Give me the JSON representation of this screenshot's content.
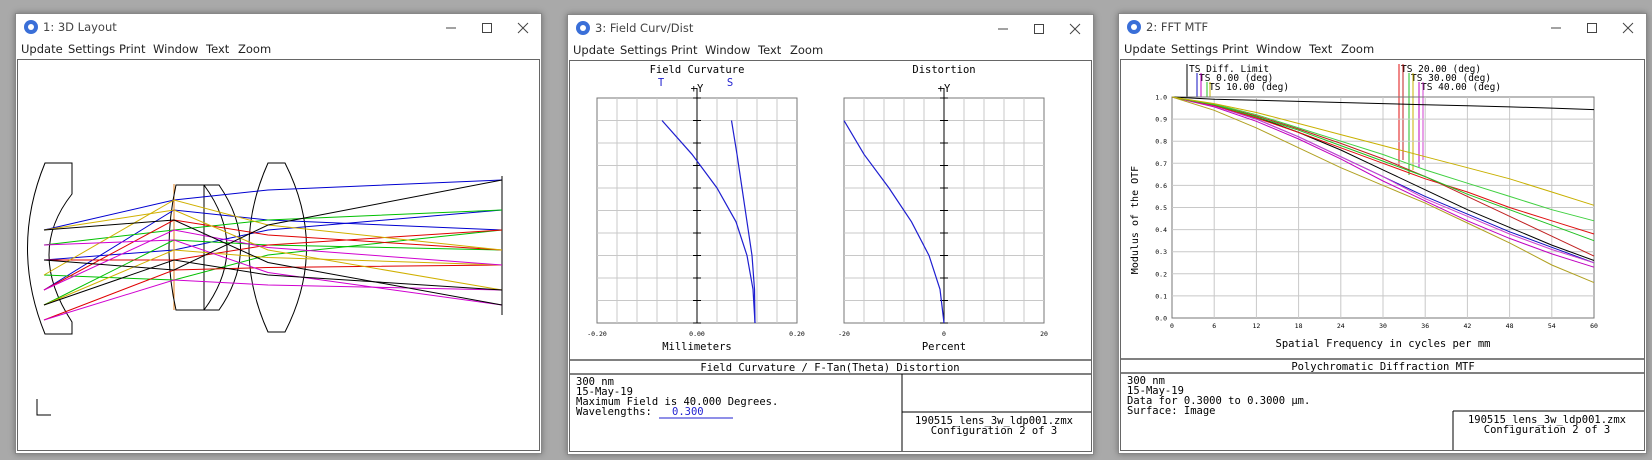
{
  "windows": [
    {
      "title": "1: 3D Layout",
      "menu": [
        "Update",
        "Settings",
        "Print",
        "Window",
        "Text",
        "Zoom"
      ]
    },
    {
      "title": "3: Field Curv/Dist",
      "menu": [
        "Update",
        "Settings",
        "Print",
        "Window",
        "Text",
        "Zoom"
      ],
      "field_curvature": {
        "heading": "Field Curvature",
        "t_label": "T",
        "s_label": "S",
        "y_label": "+Y",
        "x_ticks": [
          "-0.20",
          "0.00",
          "0.20"
        ],
        "xlabel": "Millimeters"
      },
      "distortion": {
        "heading": "Distortion",
        "y_label": "+Y",
        "x_ticks": [
          "-20",
          "0",
          "20"
        ],
        "xlabel": "Percent"
      },
      "footer_title": "Field Curvature / F-Tan(Theta) Distortion",
      "info_lines": [
        "300 nm",
        "15-May-19",
        "Maximum Field is 40.000 Degrees."
      ],
      "wavelengths_label": "Wavelengths:",
      "wavelengths_value": "0.300",
      "file": "190515_lens_3w_ldp001.zmx",
      "config": "Configuration 2 of 3"
    },
    {
      "title": "2: FFT MTF",
      "menu": [
        "Update",
        "Settings",
        "Print",
        "Window",
        "Text",
        "Zoom"
      ],
      "legend": {
        "diff": "TS Diff. Limit",
        "f0": "TS 0.00 (deg)",
        "f10": "TS 10.00 (deg)",
        "f20": "TS 20.00 (deg)",
        "f30": "TS 30.00 (deg)",
        "f40": "TS 40.00 (deg)"
      },
      "y_ticks": [
        "0.0",
        "0.1",
        "0.2",
        "0.3",
        "0.4",
        "0.5",
        "0.6",
        "0.7",
        "0.8",
        "0.9",
        "1.0"
      ],
      "x_ticks": [
        "0",
        "6",
        "12",
        "18",
        "24",
        "30",
        "36",
        "42",
        "48",
        "54",
        "60"
      ],
      "ylabel": "Modulus of the OTF",
      "xlabel": "Spatial Frequency in cycles per mm",
      "footer_title": "Polychromatic Diffraction MTF",
      "info_lines": [
        "300 nm",
        "15-May-19",
        "Data for 0.3000 to 0.3000 µm.",
        "Surface: Image"
      ],
      "file": "190515_lens_3w_ldp001.zmx",
      "config": "Configuration 2 of 3"
    }
  ],
  "chart_data": [
    {
      "type": "line",
      "title": "Field Curvature",
      "xlabel": "Millimeters",
      "xlim": [
        -0.2,
        0.2
      ],
      "ylim": [
        0,
        40
      ],
      "series": [
        {
          "name": "T",
          "x": [
            0.116,
            0.112,
            0.1,
            0.078,
            0.04,
            -0.01,
            -0.07
          ],
          "y": [
            0,
            6,
            12,
            18,
            24,
            30,
            36
          ]
        },
        {
          "name": "S",
          "x": [
            0.116,
            0.115,
            0.11,
            0.1,
            0.09,
            0.08,
            0.069
          ],
          "y": [
            0,
            6,
            12,
            18,
            24,
            30,
            36
          ]
        }
      ],
      "colors": {
        "T": "#1f1fd0",
        "S": "#1f1fd0"
      }
    },
    {
      "type": "line",
      "title": "Distortion",
      "xlabel": "Percent",
      "xlim": [
        -20,
        20
      ],
      "ylim": [
        0,
        40
      ],
      "series": [
        {
          "x": [
            0,
            -0.8,
            -3,
            -6.5,
            -11,
            -16,
            -20
          ],
          "y": [
            0,
            6,
            12,
            18,
            24,
            30,
            36
          ]
        }
      ]
    },
    {
      "type": "line",
      "title": "Polychromatic Diffraction MTF",
      "xlabel": "Spatial Frequency in cycles per mm",
      "ylabel": "Modulus of the OTF",
      "xlim": [
        0,
        60
      ],
      "ylim": [
        0,
        1
      ],
      "x": [
        0,
        6,
        12,
        18,
        24,
        30,
        36,
        42,
        48,
        54,
        60
      ],
      "series": [
        {
          "name": "TS Diff. Limit",
          "color": "#000000",
          "values": [
            1.0,
            0.99,
            0.985,
            0.98,
            0.975,
            0.97,
            0.965,
            0.96,
            0.955,
            0.95,
            0.943
          ]
        },
        {
          "name": "TS 0.00 (deg) T",
          "color": "#1010c0",
          "values": [
            1.0,
            0.96,
            0.9,
            0.82,
            0.73,
            0.64,
            0.55,
            0.47,
            0.39,
            0.32,
            0.25
          ]
        },
        {
          "name": "TS 0.00 (deg) S",
          "color": "#000000",
          "values": [
            1.0,
            0.965,
            0.91,
            0.84,
            0.76,
            0.67,
            0.58,
            0.49,
            0.41,
            0.33,
            0.26
          ]
        },
        {
          "name": "TS 10.00 (deg) T",
          "color": "#c000c0",
          "values": [
            1.0,
            0.955,
            0.89,
            0.81,
            0.72,
            0.62,
            0.53,
            0.44,
            0.36,
            0.29,
            0.23
          ]
        },
        {
          "name": "TS 10.00 (deg) S",
          "color": "#d040d0",
          "values": [
            1.0,
            0.96,
            0.9,
            0.82,
            0.73,
            0.64,
            0.54,
            0.46,
            0.38,
            0.31,
            0.25
          ]
        },
        {
          "name": "TS 20.00 (deg) T",
          "color": "#e01010",
          "values": [
            1.0,
            0.962,
            0.905,
            0.84,
            0.77,
            0.7,
            0.63,
            0.57,
            0.5,
            0.44,
            0.38
          ]
        },
        {
          "name": "TS 20.00 (deg) S",
          "color": "#c02020",
          "values": [
            1.0,
            0.965,
            0.915,
            0.855,
            0.79,
            0.72,
            0.64,
            0.55,
            0.46,
            0.37,
            0.28
          ]
        },
        {
          "name": "TS 30.00 (deg) T",
          "color": "#20c020",
          "values": [
            1.0,
            0.965,
            0.91,
            0.85,
            0.78,
            0.71,
            0.64,
            0.56,
            0.49,
            0.42,
            0.35
          ]
        },
        {
          "name": "TS 30.00 (deg) S",
          "color": "#40d040",
          "values": [
            1.0,
            0.968,
            0.92,
            0.86,
            0.8,
            0.74,
            0.67,
            0.61,
            0.55,
            0.49,
            0.44
          ]
        },
        {
          "name": "TS 40.00 (deg) T",
          "color": "#c8b000",
          "values": [
            1.0,
            0.97,
            0.93,
            0.88,
            0.83,
            0.78,
            0.73,
            0.68,
            0.63,
            0.57,
            0.51
          ]
        },
        {
          "name": "TS 40.00 (deg) S",
          "color": "#b0a020",
          "values": [
            1.0,
            0.94,
            0.86,
            0.77,
            0.68,
            0.6,
            0.52,
            0.43,
            0.34,
            0.24,
            0.16
          ]
        }
      ]
    }
  ]
}
